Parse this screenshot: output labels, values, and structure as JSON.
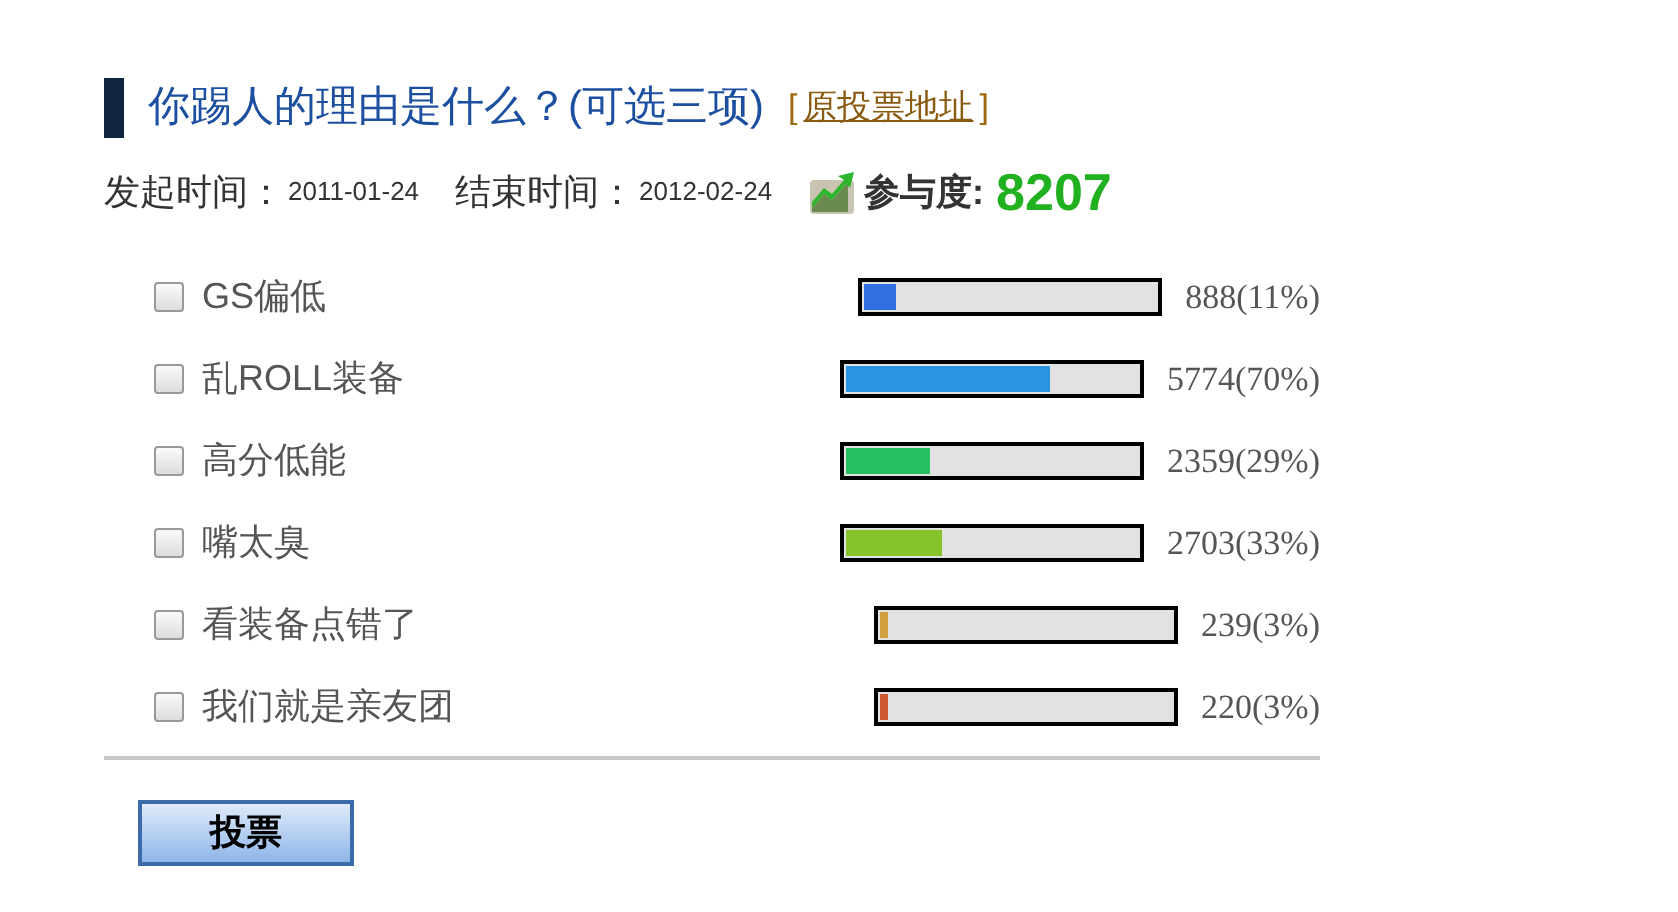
{
  "poll": {
    "title": "你踢人的理由是什么？(可选三项)",
    "source_link": "原投票地址",
    "bracket_open": "[",
    "bracket_close": "]"
  },
  "meta": {
    "start_label": "发起时间：",
    "start_date": "2011-01-24",
    "end_label": "结束时间：",
    "end_date": "2012-02-24",
    "participation_label": "参与度:",
    "participation_count": "8207"
  },
  "options": [
    {
      "label": "GS偏低",
      "checked": false,
      "level": 0.11,
      "color": "#2f6fe0",
      "result": "888(11%)"
    },
    {
      "label": "乱ROLL装备",
      "checked": false,
      "level": 0.7,
      "color": "#2a94e0",
      "result": "5774(70%)"
    },
    {
      "label": "高分低能",
      "checked": false,
      "level": 0.29,
      "color": "#27c060",
      "result": "2359(29%)"
    },
    {
      "label": "嘴太臭",
      "checked": false,
      "level": 0.33,
      "color": "#86c22a",
      "result": "2703(33%)"
    },
    {
      "label": "看装备点错了",
      "checked": false,
      "level": 0.03,
      "color": "#d0a040",
      "result": "239(3%)"
    },
    {
      "label": "我们就是亲友团",
      "checked": false,
      "level": 0.03,
      "color": "#d05a30",
      "result": "220(3%)"
    }
  ],
  "vote_button": "投票"
}
